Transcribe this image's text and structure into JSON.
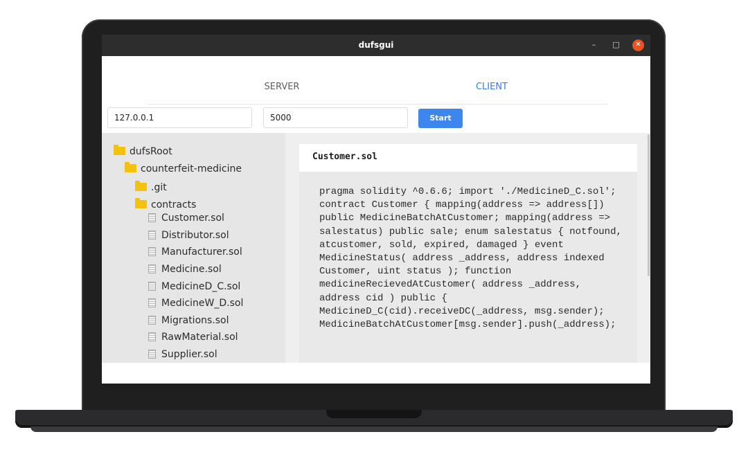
{
  "window": {
    "title": "dufsgui"
  },
  "tabs": {
    "server": "SERVER",
    "client": "CLIENT"
  },
  "connection": {
    "host": "127.0.0.1",
    "port": "5000",
    "start_label": "Start"
  },
  "tree": {
    "root": "dufsRoot",
    "project": "counterfeit-medicine",
    "git": ".git",
    "contracts": "contracts",
    "files": [
      "Customer.sol",
      "Distributor.sol",
      "Manufacturer.sol",
      "Medicine.sol",
      "MedicineD_C.sol",
      "MedicineW_D.sol",
      "Migrations.sol",
      "RawMaterial.sol",
      "Supplier.sol"
    ]
  },
  "viewer": {
    "filename": "Customer.sol",
    "content": "pragma solidity ^0.6.6; import './MedicineD_C.sol'; contract Customer { mapping(address => address[]) public MedicineBatchAtCustomer; mapping(address => salestatus) public sale; enum salestatus { notfound, atcustomer, sold, expired, damaged } event MedicineStatus( address _address, address indexed Customer, uint status ); function medicineRecievedAtCustomer( address _address, address cid ) public { MedicineD_C(cid).receiveDC(_address, msg.sender); MedicineBatchAtCustomer[msg.sender].push(_address);"
  },
  "colors": {
    "accent": "#3d86f0",
    "active_tab": "#2f7de1",
    "folder": "#f4c20d",
    "close": "#e95420"
  }
}
